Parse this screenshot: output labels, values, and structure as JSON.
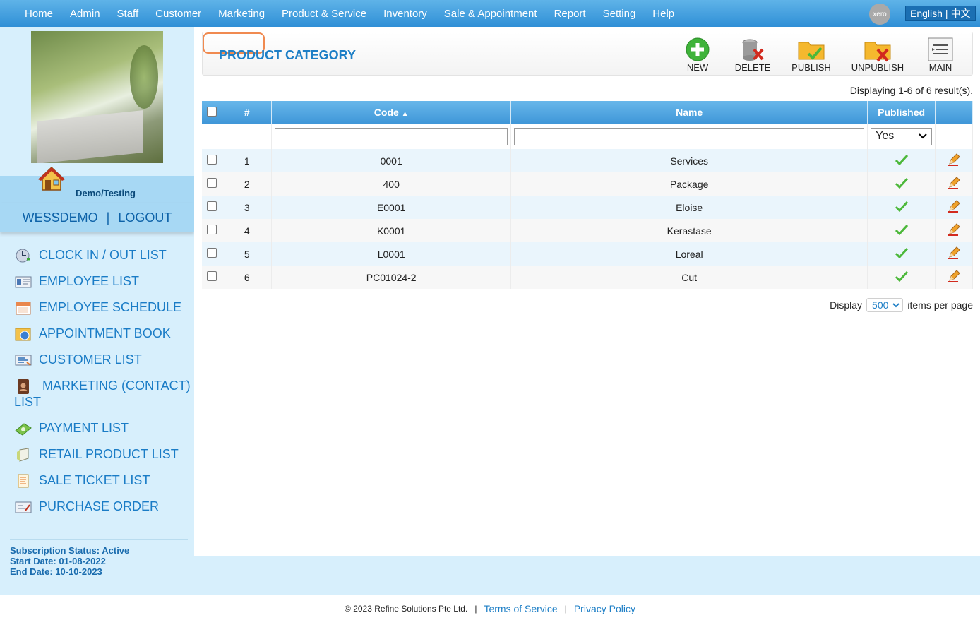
{
  "nav": {
    "items": [
      "Home",
      "Admin",
      "Staff",
      "Customer",
      "Marketing",
      "Product & Service",
      "Inventory",
      "Sale & Appointment",
      "Report",
      "Setting",
      "Help"
    ],
    "xero_label": "xero",
    "lang_en": "English",
    "lang_sep": "|",
    "lang_zh": "中文"
  },
  "sidebar": {
    "tenant": "Demo/Testing",
    "username": "WESSDEMO",
    "sep": "|",
    "logout": "LOGOUT",
    "links": [
      {
        "label": "CLOCK IN / OUT LIST",
        "icon": "clock-icon"
      },
      {
        "label": "EMPLOYEE LIST",
        "icon": "id-card-icon"
      },
      {
        "label": "EMPLOYEE SCHEDULE",
        "icon": "calendar-icon"
      },
      {
        "label": "APPOINTMENT BOOK",
        "icon": "appointment-icon"
      },
      {
        "label": "CUSTOMER LIST",
        "icon": "customer-card-icon"
      },
      {
        "label": "MARKETING (CONTACT) LIST",
        "icon": "contact-book-icon"
      },
      {
        "label": "PAYMENT LIST",
        "icon": "money-icon"
      },
      {
        "label": "RETAIL PRODUCT LIST",
        "icon": "box-icon"
      },
      {
        "label": "SALE TICKET LIST",
        "icon": "ticket-icon"
      },
      {
        "label": "PURCHASE ORDER",
        "icon": "purchase-order-icon"
      }
    ],
    "subscription": {
      "status": "Subscription Status: Active",
      "start": "Start Date: 01-08-2022",
      "end": "End Date: 10-10-2023"
    }
  },
  "page": {
    "title": "PRODUCT CATEGORY",
    "toolbar": {
      "new": "NEW",
      "delete": "DELETE",
      "publish": "PUBLISH",
      "unpublish": "UNPUBLISH",
      "main": "MAIN"
    },
    "results": "Displaying 1-6 of 6 result(s).",
    "columns": {
      "num": "#",
      "code": "Code",
      "name": "Name",
      "published": "Published"
    },
    "filter": {
      "published": "Yes"
    },
    "rows": [
      {
        "num": "1",
        "code": "0001",
        "name": "Services"
      },
      {
        "num": "2",
        "code": "400",
        "name": "Package"
      },
      {
        "num": "3",
        "code": "E0001",
        "name": "Eloise"
      },
      {
        "num": "4",
        "code": "K0001",
        "name": "Kerastase"
      },
      {
        "num": "5",
        "code": "L0001",
        "name": "Loreal"
      },
      {
        "num": "6",
        "code": "PC01024-2",
        "name": "Cut"
      }
    ],
    "pager": {
      "display": "Display",
      "per_page": "500",
      "suffix": "items per page"
    }
  },
  "footer": {
    "copyright": "© 2023 Refine Solutions Pte Ltd.",
    "sep": "|",
    "terms": "Terms of Service",
    "privacy": "Privacy Policy"
  }
}
